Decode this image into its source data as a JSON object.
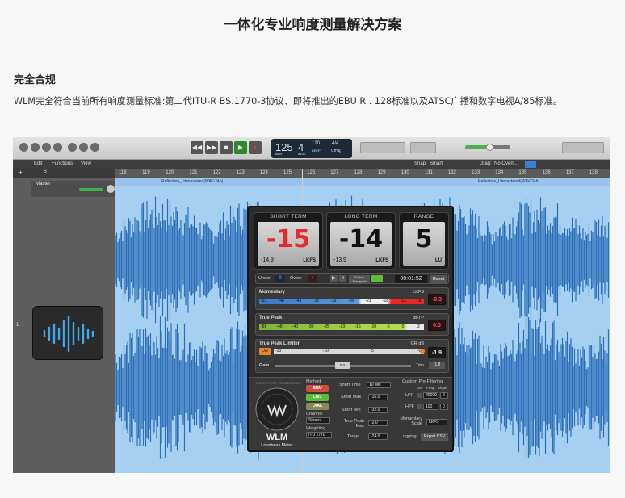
{
  "article": {
    "title": "一体化专业响度测量解决方案",
    "section_title": "完全合规",
    "paragraph": "WLM完全符合当前所有响度测量标准:第二代ITU-R BS.1770-3协议、即将推出的EBU R . 128标准以及ATSC广播和数字电视A/85标准。"
  },
  "daw": {
    "lcd": {
      "tempo": "125",
      "beat": "4",
      "bpm_label": "120",
      "keep_label": "KEEP",
      "sig_top": "4/4",
      "key": "Cmaj",
      "sub1": "BAR",
      "sub2": "BEAT"
    },
    "menu": {
      "edit": "Edit",
      "functions": "Functions",
      "view": "View",
      "snap_label": "Snap:",
      "snap_value": "Smart",
      "drag_label": "Drag:",
      "drag_value": "No Overl..."
    },
    "ruler_marks": [
      "118",
      "119",
      "120",
      "121",
      "122",
      "123",
      "124",
      "125",
      "126",
      "127",
      "128",
      "129",
      "130",
      "131",
      "132",
      "133",
      "134",
      "135",
      "136",
      "137",
      "138"
    ],
    "track": {
      "name": "Master",
      "number": "1"
    },
    "region_labels": [
      "Reflection_Unmastered(WAV-24b)",
      "Reflection_Unmastered(WAV-24b)"
    ]
  },
  "wlm": {
    "short_term": {
      "title": "SHORT TERM",
      "value": "-15",
      "min": "-14.9",
      "unit": "LKFS"
    },
    "long_term": {
      "title": "LONG TERM",
      "value": "-14",
      "min": "-13.9",
      "unit": "LKFS"
    },
    "range": {
      "title": "RANGE",
      "value": "5",
      "unit": "LU"
    },
    "transport": {
      "under_label": "Under",
      "under_value": "0",
      "over_label": "Overs",
      "over_value": "4",
      "follow_label": "Follow Transport",
      "time": "00:01:52",
      "reset": "Reset"
    },
    "momentary": {
      "label": "Momentary",
      "unit": "LKFS",
      "value": "-9.3",
      "scale": [
        "-53",
        "-48",
        "-43",
        "-38",
        "-33",
        "-28",
        "-23",
        "-18",
        "-13",
        "-8"
      ]
    },
    "true_peak": {
      "label": "True Peak",
      "unit": "dBTP",
      "value": "0.0",
      "scale": [
        "-58",
        "-48",
        "-40",
        "-30",
        "-25",
        "-20",
        "-15",
        "-10",
        "-5",
        "0",
        "2"
      ]
    },
    "limiter": {
      "label": "True Peak Limiter",
      "unit": "GR dB",
      "value": "-1.9",
      "button": "ON",
      "scale": [
        "-10",
        "-10",
        "-5",
        "-0"
      ],
      "gain_label": "Gain",
      "gain_value": "0.0",
      "trim_label": "Trim",
      "trim_value": "-1.8"
    },
    "brand": {
      "logo_text": "WAVES POST PRODUCTION",
      "name": "WLM",
      "subtitle": "Loudness Meter"
    },
    "method": {
      "label": "Method",
      "options": [
        "EBU",
        "LM1",
        "DIAL"
      ]
    },
    "channel": {
      "label": "Channel",
      "value": "Stereo"
    },
    "weighting": {
      "label": "Weighting",
      "value": "ITU 1770"
    },
    "settings": {
      "short_time_label": "Short Time",
      "short_time_value": "10 sec",
      "short_max_label": "Short Max",
      "short_max_value": "-16.0",
      "short_min_label": "Short Min",
      "short_min_value": "-32.0",
      "true_peak_max_label": "True Peak Max",
      "true_peak_max_value": "-2.0",
      "target_label": "Target",
      "target_value": "-24.0"
    },
    "prefilter": {
      "label": "Custom Pre Filtering",
      "col1": "On",
      "col2": "Freq",
      "col3": "Slope",
      "lpf_label": "LPF",
      "lpf_freq": "20000",
      "lpf_slope": "0",
      "hpf_label": "HPF",
      "hpf_freq": "100",
      "hpf_slope": "0"
    },
    "momentary_scale": {
      "label": "Momentary Scale",
      "value": "LKFS"
    },
    "logging": {
      "label": "Logging",
      "button": "Export CSV"
    }
  },
  "colors": {
    "accent_red": "#e8292a",
    "meter_blue": "#3b79c9",
    "meter_green": "#9bd03e",
    "limiter_orange": "#e8862a",
    "waveform_blue": "#2f6fb8",
    "waveform_bg": "#a6d0f2"
  }
}
